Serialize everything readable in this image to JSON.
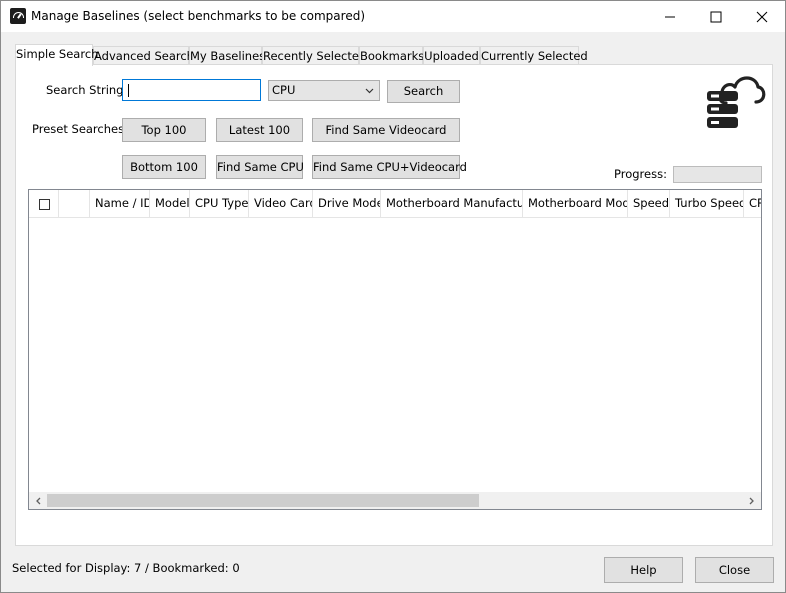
{
  "window": {
    "title": "Manage Baselines (select benchmarks to be compared)"
  },
  "tabs": [
    {
      "label": "Simple Search",
      "active": true
    },
    {
      "label": "Advanced Search",
      "active": false
    },
    {
      "label": "My Baselines",
      "active": false
    },
    {
      "label": "Recently Selected",
      "active": false
    },
    {
      "label": "Bookmarks",
      "active": false
    },
    {
      "label": "Uploaded",
      "active": false
    },
    {
      "label": "Currently Selected",
      "active": false
    }
  ],
  "search": {
    "label": "Search String:",
    "value": "",
    "type_selected": "CPU",
    "button": "Search"
  },
  "presets": {
    "label": "Preset Searches:",
    "top100": "Top 100",
    "latest100": "Latest 100",
    "same_videocard": "Find Same Videocard",
    "bottom100": "Bottom 100",
    "same_cpu": "Find Same CPU",
    "same_cpu_videocard": "Find Same CPU+Videocard"
  },
  "progress": {
    "label": "Progress:",
    "value": 0
  },
  "table": {
    "columns": [
      "Name / ID",
      "Model",
      "CPU Type",
      "Video Card",
      "Drive Model",
      "Motherboard Manufacturer",
      "Motherboard Model",
      "Speed",
      "Turbo Speed",
      "CPU"
    ],
    "rows": []
  },
  "status": {
    "text": "Selected for Display: 7 / Bookmarked: 0"
  },
  "footer": {
    "help": "Help",
    "close": "Close"
  },
  "colors": {
    "accent": "#0078d7",
    "window_bg": "#f0f0f0",
    "button_bg": "#e1e1e1",
    "icon_dark": "#222222"
  },
  "icons": [
    "app-gauge-icon",
    "minimize-icon",
    "maximize-icon",
    "close-icon",
    "chevron-down-icon",
    "cloud-database-icon",
    "star-icon",
    "scroll-left-icon",
    "scroll-right-icon"
  ]
}
